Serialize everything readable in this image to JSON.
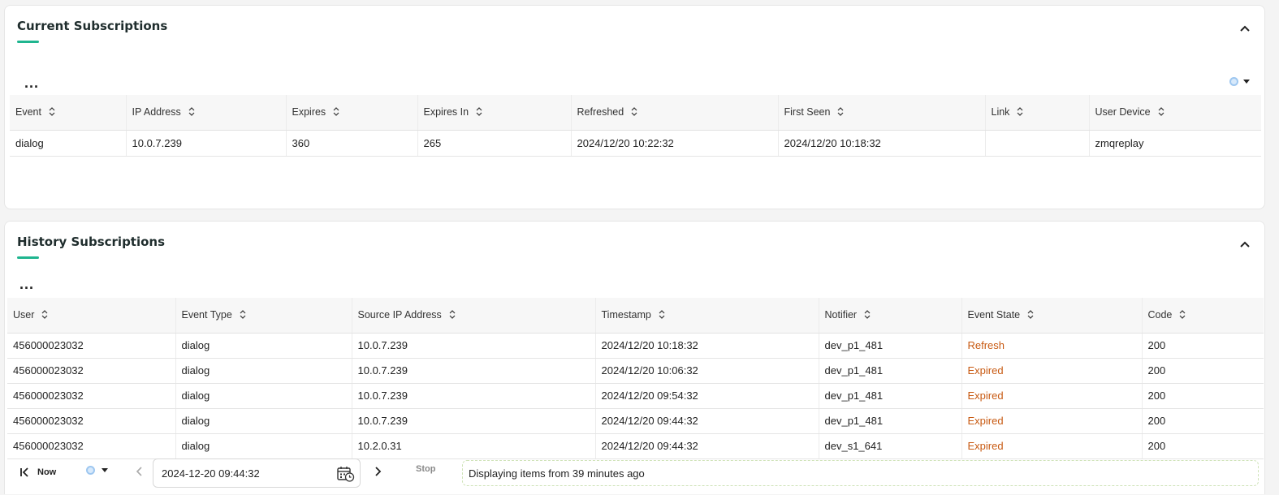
{
  "current": {
    "title": "Current Subscriptions",
    "more_label": "...",
    "columns": [
      "Event",
      "IP Address",
      "Expires",
      "Expires In",
      "Refreshed",
      "First Seen",
      "Link",
      "User Device"
    ],
    "rows": [
      [
        "dialog",
        "10.0.7.239",
        "360",
        "265",
        "2024/12/20 10:22:32",
        "2024/12/20 10:18:32",
        "",
        "zmqreplay"
      ]
    ]
  },
  "history": {
    "title": "History Subscriptions",
    "more_label": "...",
    "columns": [
      "User",
      "Event Type",
      "Source IP Address",
      "Timestamp",
      "Notifier",
      "Event State",
      "Code"
    ],
    "rows": [
      [
        "456000023032",
        "dialog",
        "10.0.7.239",
        "2024/12/20 10:18:32",
        "dev_p1_481",
        "Refresh",
        "200"
      ],
      [
        "456000023032",
        "dialog",
        "10.0.7.239",
        "2024/12/20 10:06:32",
        "dev_p1_481",
        "Expired",
        "200"
      ],
      [
        "456000023032",
        "dialog",
        "10.0.7.239",
        "2024/12/20 09:54:32",
        "dev_p1_481",
        "Expired",
        "200"
      ],
      [
        "456000023032",
        "dialog",
        "10.0.7.239",
        "2024/12/20 09:44:32",
        "dev_p1_481",
        "Expired",
        "200"
      ],
      [
        "456000023032",
        "dialog",
        "10.2.0.31",
        "2024/12/20 09:44:32",
        "dev_s1_641",
        "Expired",
        "200"
      ]
    ]
  },
  "footer": {
    "now_label": "Now",
    "date_value": "2024-12-20 09:44:32",
    "stop_label": "Stop",
    "status_text": "Displaying items from 39 minutes ago"
  },
  "colors": {
    "accent": "#1fb58f",
    "state_text": "#c85a12"
  }
}
